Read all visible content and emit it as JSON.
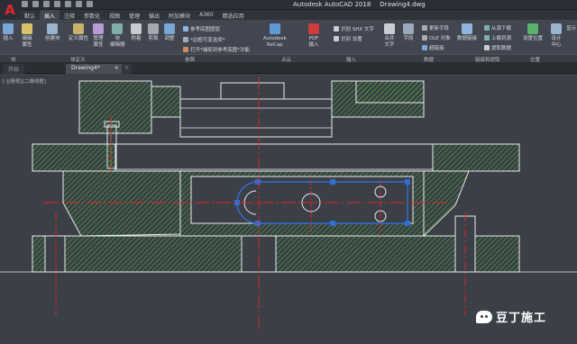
{
  "app": {
    "title": "Autodesk AutoCAD 2018",
    "document": "Drawing4.dwg",
    "logo_letter": "A"
  },
  "ribbon_tabs": [
    "默认",
    "插入",
    "注释",
    "参数化",
    "视图",
    "管理",
    "输出",
    "附加模块",
    "A360",
    "精选应用"
  ],
  "active_tab": "插入",
  "ribbon": {
    "insert": "插入",
    "edit_attribute": "编辑\n属性",
    "create_block": "创建块",
    "define_attribute": "定义属性",
    "manage_attribute": "管理\n属性",
    "block_editor": "块\n编辑器",
    "attach": "附着",
    "clip": "剪裁",
    "adjust": "调整",
    "underlay_layers": "参考底图图层",
    "frames_vary": "*边框可变选项*",
    "snap_to_underlays": "打开*捕捉到参考底图*功能",
    "recap": "Autodesk\nReCap",
    "pdf_import": "PDF\n输入",
    "shx_text": "识别 SHX 文字",
    "recognition_settings": "识别 设置",
    "combine_text": "合并\n文字",
    "field": "字段",
    "update_fields": "更新字段",
    "ole_object": "OLE 对象",
    "hyperlink": "超链接",
    "data_link": "数据链接",
    "download_from_source": "从源下载",
    "upload_to_source": "上载到源",
    "extract_data": "提取数据",
    "set_location": "设置位置",
    "design_center": "设计\n中心",
    "extra": "显示"
  },
  "panels": {
    "block": "块",
    "block_definition": "块定义",
    "reference": "参照",
    "point_cloud": "点云",
    "import": "输入",
    "data": "数据",
    "linking_extraction": "链接和提取",
    "location": "位置"
  },
  "doc_tabs": [
    "开始",
    "Drawing4*"
  ],
  "active_doc_tab": "Drawing4*",
  "viewport_label": "[-][俯视][二维线框]",
  "watermark": "豆丁施工",
  "colors": {
    "canvas_bg": "#3b3f46",
    "outline": "#e8ecef",
    "hatch": "#4cbf3a",
    "centerline": "#e0262d",
    "selection": "#2f6fd6",
    "grip": "#2f6fd6"
  }
}
